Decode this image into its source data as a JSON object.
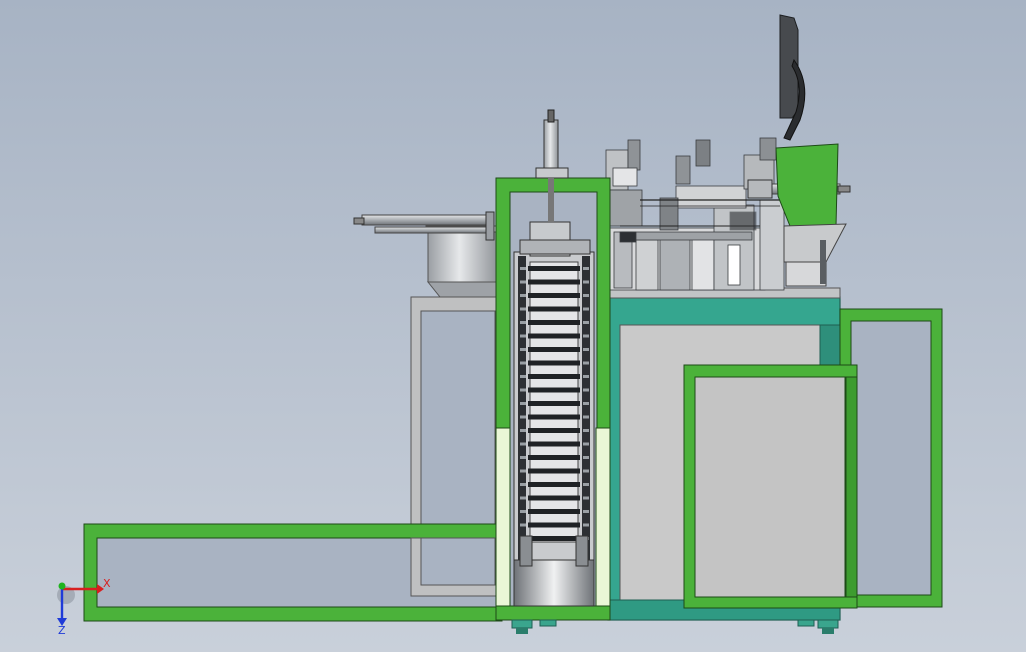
{
  "viewport": {
    "background_top": "#a7b3c4",
    "background_bottom": "#c9d0da"
  },
  "triad": {
    "x_label": "X",
    "z_label": "Z",
    "x_color": "#d81f1f",
    "y_color": "#1fb31f",
    "z_color": "#1f3bd8"
  },
  "colors": {
    "frame_green": "#4bb23a",
    "frame_outline": "#1d4a17",
    "cabinet_teal": "#35a68f",
    "panel_grey": "#c8c8c8",
    "light_panel": "#eaf7d6",
    "steel": "#b9bcc0",
    "dark_steel": "#4e5256"
  },
  "icons": {
    "view_triad": "xyz-axis-triad-icon"
  }
}
